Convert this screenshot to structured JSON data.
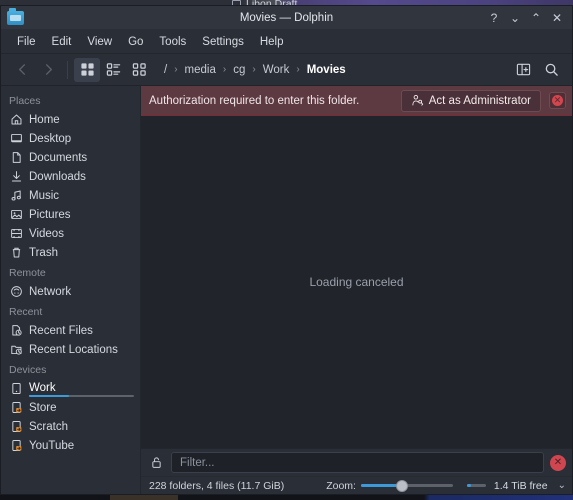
{
  "desktop": {
    "background_label": "Libon Draft"
  },
  "window": {
    "title": "Movies — Dolphin",
    "app_icon": "folder-icon",
    "controls": [
      {
        "name": "help-button",
        "glyph": "?"
      },
      {
        "name": "minimize-button",
        "glyph": "⌄"
      },
      {
        "name": "maximize-button",
        "glyph": "⌃"
      },
      {
        "name": "close-button",
        "glyph": "✕"
      }
    ]
  },
  "menubar": {
    "items": [
      {
        "label": "File"
      },
      {
        "label": "Edit"
      },
      {
        "label": "View"
      },
      {
        "label": "Go"
      },
      {
        "label": "Tools"
      },
      {
        "label": "Settings"
      },
      {
        "label": "Help"
      }
    ]
  },
  "toolbar": {
    "back_label": "Back",
    "forward_label": "Forward",
    "view_modes": [
      {
        "name": "icons-view-button",
        "label": "Icons",
        "active": true
      },
      {
        "name": "details-view-button",
        "label": "Details",
        "active": false
      },
      {
        "name": "compact-view-button",
        "label": "Compact",
        "active": false
      }
    ],
    "split_label": "Split",
    "search_label": "Search"
  },
  "breadcrumb": {
    "root": "/",
    "segments": [
      {
        "label": "media",
        "current": false
      },
      {
        "label": "cg",
        "current": false
      },
      {
        "label": "Work",
        "current": false
      },
      {
        "label": "Movies",
        "current": true
      }
    ],
    "separator": "›"
  },
  "sidebar": {
    "groups": [
      {
        "title": "Places",
        "items": [
          {
            "label": "Home",
            "icon": "home-icon",
            "selected": false
          },
          {
            "label": "Desktop",
            "icon": "desktop-icon",
            "selected": false
          },
          {
            "label": "Documents",
            "icon": "document-icon",
            "selected": false
          },
          {
            "label": "Downloads",
            "icon": "download-icon",
            "selected": false
          },
          {
            "label": "Music",
            "icon": "music-note-icon",
            "selected": false
          },
          {
            "label": "Pictures",
            "icon": "picture-icon",
            "selected": false
          },
          {
            "label": "Videos",
            "icon": "video-icon",
            "selected": false
          },
          {
            "label": "Trash",
            "icon": "trash-icon",
            "selected": false
          }
        ]
      },
      {
        "title": "Remote",
        "items": [
          {
            "label": "Network",
            "icon": "network-icon",
            "selected": false
          }
        ]
      },
      {
        "title": "Recent",
        "items": [
          {
            "label": "Recent Files",
            "icon": "recent-file-icon",
            "selected": false
          },
          {
            "label": "Recent Locations",
            "icon": "recent-folder-icon",
            "selected": false
          }
        ]
      },
      {
        "title": "Devices",
        "items": [
          {
            "label": "Work",
            "icon": "drive-icon",
            "selected": true,
            "capacity_percent": 38
          },
          {
            "label": "Store",
            "icon": "drive-mounted-icon",
            "selected": false
          },
          {
            "label": "Scratch",
            "icon": "drive-mounted-icon",
            "selected": false
          },
          {
            "label": "YouTube",
            "icon": "drive-mounted-icon",
            "selected": false
          }
        ]
      }
    ]
  },
  "auth_banner": {
    "message": "Authorization required to enter this folder.",
    "admin_button_label": "Act as Administrator",
    "admin_button_icon": "user-key-icon",
    "close_icon": "close-icon",
    "background_color": "#5d3942"
  },
  "view": {
    "message": "Loading canceled"
  },
  "filter_bar": {
    "lock_icon": "unlock-icon",
    "placeholder": "Filter...",
    "value": "",
    "close_icon": "close-icon"
  },
  "statusbar": {
    "count_text": "228 folders, 4 files (11.7 GiB)",
    "zoom_label": "Zoom:",
    "zoom_percent": 45,
    "free_meter_percent": 22,
    "free_text": "1.4 TiB free",
    "chevron": "⌄"
  },
  "colors": {
    "accent": "#3d9ad9",
    "window_bg": "#2a2e36",
    "view_bg": "#21242b",
    "warning_bg": "#5d3942",
    "danger": "#cf4650"
  }
}
